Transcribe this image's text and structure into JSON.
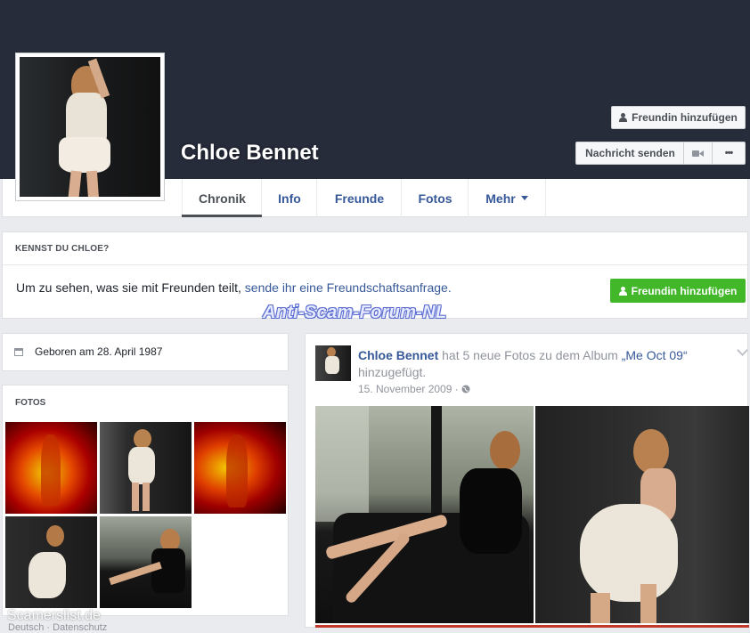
{
  "profile": {
    "name": "Chloe Bennet"
  },
  "header_buttons": {
    "add_friend": "Freundin hinzufügen",
    "message": "Nachricht senden",
    "more": "•••"
  },
  "nav": {
    "tabs": [
      {
        "label": "Chronik"
      },
      {
        "label": "Info"
      },
      {
        "label": "Freunde"
      },
      {
        "label": "Fotos"
      },
      {
        "label": "Mehr"
      }
    ]
  },
  "know_box": {
    "title": "KENNST DU CHLOE?",
    "text": "Um zu sehen, was sie mit Freunden teilt, ",
    "link": "sende ihr eine Freundschaftsanfrage.",
    "button": "Freundin hinzufügen"
  },
  "watermarks": {
    "forum": "Anti-Scam-Forum-NL",
    "site": "Scamerslist.de"
  },
  "intro": {
    "birthday": "Geboren am 28. April 1987"
  },
  "photos": {
    "title": "FOTOS"
  },
  "footer": {
    "links": "Deutsch · Datenschutz"
  },
  "post": {
    "author": "Chloe Bennet",
    "action": " hat 5 neue Fotos zu dem Album ",
    "album": "„Me Oct 09“",
    "action_end": " hinzugefügt.",
    "date": "15. November 2009",
    "privacy": "·"
  },
  "colors": {
    "cover": "#272c3b",
    "link": "#365899",
    "green_button": "#42b72a",
    "page_bg": "#e9ebee"
  },
  "icons": [
    "person-add-icon",
    "video-camera-icon",
    "more-dots-icon",
    "caret-down-icon",
    "calendar-icon",
    "globe-icon",
    "chevron-down-icon"
  ]
}
